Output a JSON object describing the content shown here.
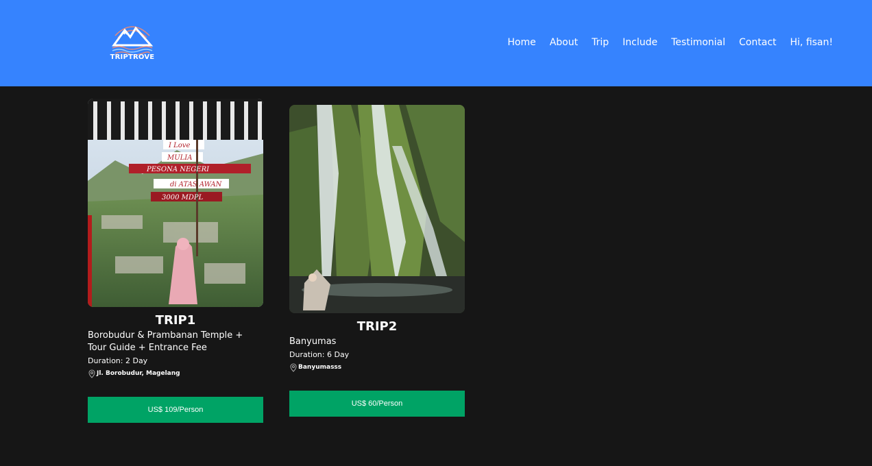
{
  "brand": {
    "name": "TRIPTROVE"
  },
  "nav": {
    "items": [
      "Home",
      "About",
      "Trip",
      "Include",
      "Testimonial",
      "Contact",
      "Hi, fisan!"
    ]
  },
  "trips": [
    {
      "title": "TRIP1",
      "description": "Borobudur & Prambanan Temple + Tour Guide + Entrance Fee",
      "duration": "Duration: 2 Day",
      "location": "Jl. Borobudur, Magelang",
      "price": "US$ 109/Person",
      "sign_texts": [
        "I Love",
        "MULIA",
        "PESONA NEGERI",
        "di ATAS AWAN",
        "3000 MDPL"
      ]
    },
    {
      "title": "TRIP2",
      "description": "Banyumas",
      "duration": "Duration: 6 Day",
      "location": "Banyumasss",
      "price": "US$ 60/Person"
    }
  ],
  "colors": {
    "header_bg": "#3683fe",
    "page_bg": "#161616",
    "button_bg": "#00a365"
  },
  "icons": [
    "location-pin-icon",
    "mountain-logo-icon"
  ]
}
